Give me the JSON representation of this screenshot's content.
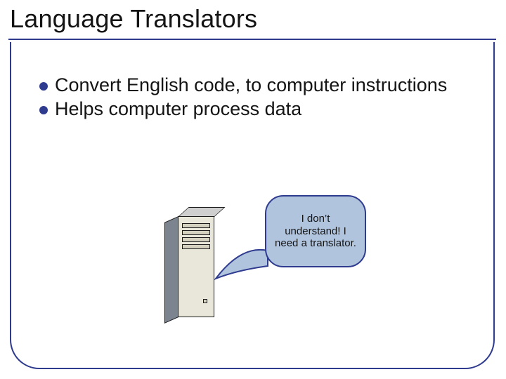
{
  "title": "Language Translators",
  "bullets": [
    "Convert English code, to computer instructions",
    "Helps computer process data"
  ],
  "bubble_text": "I don’t understand! I need a translator.",
  "colors": {
    "accent": "#2f3b8e",
    "bubble_fill": "#b0c4de"
  }
}
